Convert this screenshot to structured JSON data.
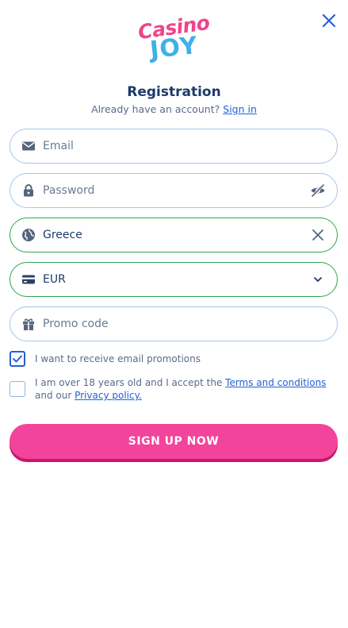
{
  "header": {
    "logo_top": "Casino",
    "logo_bottom": "JOY"
  },
  "title": "Registration",
  "subtitle": {
    "text": "Already have an account?",
    "link": "Sign in"
  },
  "fields": {
    "email": {
      "placeholder": "Email",
      "icon": "envelope-icon"
    },
    "password": {
      "placeholder": "Password",
      "icon": "lock-icon",
      "action_icon": "eye-off-icon"
    },
    "country": {
      "value": "Greece",
      "icon": "globe-icon",
      "action_icon": "close-icon"
    },
    "currency": {
      "value": "EUR",
      "icon": "credit-card-icon",
      "action_icon": "chevron-down-icon"
    },
    "promo": {
      "placeholder": "Promo code",
      "icon": "gift-icon"
    }
  },
  "checkboxes": {
    "promotions": {
      "label": "I want to receive email promotions",
      "checked": true
    },
    "terms": {
      "text_before": "I am over 18 years old and I accept the",
      "terms_link": "Terms and conditions",
      "text_middle": "and our",
      "privacy_link": "Privacy policy.",
      "checked": false
    }
  },
  "submit_label": "SIGN UP NOW",
  "colors": {
    "primary_text": "#1d3a6b",
    "link": "#2460d9",
    "accent_pink": "#f2449a",
    "valid_green": "#2fa54b",
    "field_border": "#a6c4ea"
  }
}
